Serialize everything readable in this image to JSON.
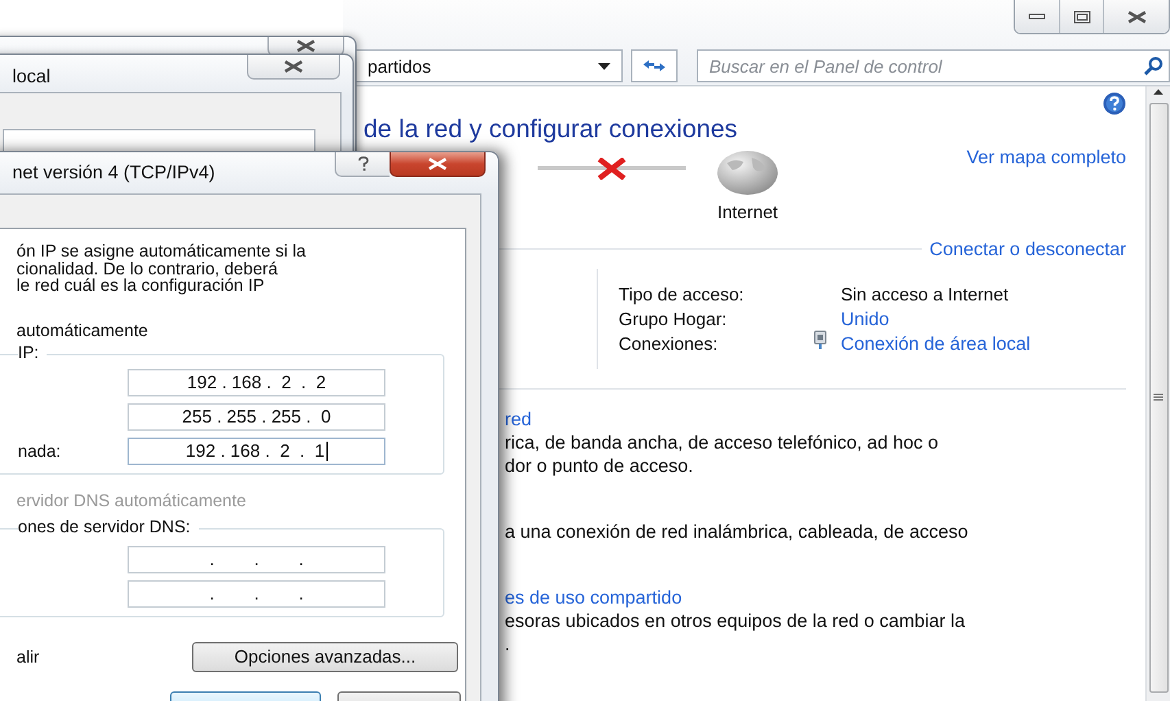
{
  "control_panel": {
    "address": "partidos",
    "search": {
      "placeholder": "Buscar en el Panel de control"
    },
    "heading": "de la red y configurar conexiones",
    "map": {
      "link": "Ver mapa completo",
      "internet_label": "Internet",
      "connected": false
    },
    "connect_link": "Conectar o desconectar",
    "details": [
      {
        "label": "Tipo de acceso:",
        "value": "Sin acceso a Internet",
        "kind": "text"
      },
      {
        "label": "Grupo Hogar:",
        "value": "Unido",
        "kind": "link"
      },
      {
        "label": "Conexiones:",
        "value": "Conexión de área local",
        "kind": "connection"
      }
    ],
    "tasks": [
      {
        "link": "red",
        "lines": [
          "rica, de banda ancha, de acceso telefónico, ad hoc o",
          "dor o punto de acceso."
        ]
      },
      {
        "lines": [
          "a una conexión de red inalámbrica, cableada, de acceso"
        ]
      },
      {
        "link": "es de uso compartido",
        "lines": [
          "esoras ubicados en otros equipos de la red o cambiar la",
          "."
        ]
      }
    ]
  },
  "local_window": {
    "title": "local"
  },
  "ipv4_dialog": {
    "title": "net versión 4 (TCP/IPv4)",
    "intro": [
      "ón IP se asigne automáticamente si la",
      "cionalidad. De lo contrario, deberá",
      "le red cuál es la configuración IP"
    ],
    "auto_ip_option": "automáticamente",
    "ip_group": {
      "label": "IP:",
      "fields": [
        {
          "value": "192 . 168 .  2  .  2",
          "focused": false
        },
        {
          "value": "255 . 255 . 255 .  0",
          "focused": false
        },
        {
          "label": "nada:",
          "value": "192 . 168 .  2  .  1",
          "focused": true
        }
      ]
    },
    "dns_auto_option": {
      "text": "ervidor DNS automáticamente",
      "disabled": true
    },
    "dns_group": {
      "label": "ones de servidor DNS:",
      "fields": [
        {
          "value": ".        .        .",
          "focused": false
        },
        {
          "value": ".        .        .",
          "focused": false
        }
      ]
    },
    "validate_text": "alir",
    "advanced_button": "Opciones avanzadas...",
    "bottom_buttons": [
      {
        "default": true
      },
      {
        "default": false
      }
    ]
  }
}
